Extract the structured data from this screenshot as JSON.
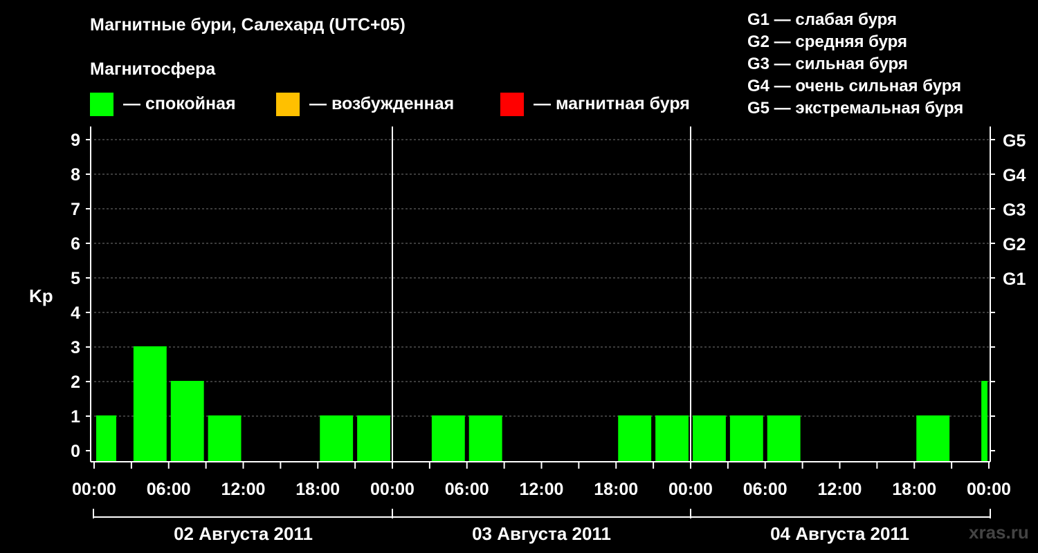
{
  "header": {
    "title": "Магнитные бури, Салехард (UTC+05)",
    "legend_title": "Магнитосфера",
    "legend": [
      {
        "color": "#00ff00",
        "label": "— спокойная"
      },
      {
        "color": "#ffc000",
        "label": "— возбужденная"
      },
      {
        "color": "#ff0000",
        "label": "— магнитная буря"
      }
    ],
    "g_scale": [
      "G1 — слабая буря",
      "G2 — средняя буря",
      "G3 — сильная буря",
      "G4 — очень сильная буря",
      "G5 — экстремальная буря"
    ]
  },
  "watermark": "xras.ru",
  "chart_data": {
    "type": "bar",
    "ylabel": "Kp",
    "ylim": [
      0,
      9
    ],
    "yticks": [
      "0",
      "1",
      "2",
      "3",
      "4",
      "5",
      "6",
      "7",
      "8",
      "9"
    ],
    "right_labels": [
      {
        "value": 5,
        "label": "G1"
      },
      {
        "value": 6,
        "label": "G2"
      },
      {
        "value": 7,
        "label": "G3"
      },
      {
        "value": 8,
        "label": "G4"
      },
      {
        "value": 9,
        "label": "G5"
      }
    ],
    "xtick_labels": [
      "00:00",
      "06:00",
      "12:00",
      "18:00",
      "00:00",
      "06:00",
      "12:00",
      "18:00",
      "00:00",
      "06:00",
      "12:00",
      "18:00",
      "00:00"
    ],
    "days": [
      "02 Августа 2011",
      "03 Августа 2011",
      "04 Августа 2011"
    ],
    "grid": true,
    "interval_hours": 3,
    "values": [
      1,
      3,
      2,
      1,
      0,
      0,
      1,
      1,
      0,
      1,
      1,
      0,
      0,
      0,
      1,
      1,
      1,
      1,
      1,
      0,
      0,
      0,
      1,
      2
    ],
    "partial_first": true,
    "partial_last": true,
    "bar_color": "#00ff00"
  }
}
